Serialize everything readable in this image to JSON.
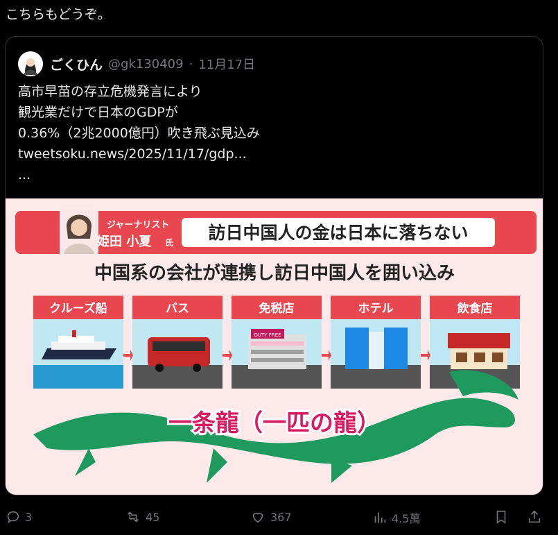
{
  "post_text": "こちらもどうぞ。",
  "quoted": {
    "author_name": "ごくひん",
    "author_handle": "@gk130409",
    "separator": "·",
    "date": "11月17日",
    "body": "高市早苗の存立危機発言により\n観光業だけで日本のGDPが\n0.36%（2兆2000億円）吹き飛ぶ見込み\ntweetsoku.news/2025/11/17/gdp...\n...",
    "image": {
      "role": "ジャーナリスト",
      "person_name": "姫田 小夏",
      "honorific": "氏",
      "headline": "訪日中国人の金は日本に落ちない",
      "subheadline": "中国系の会社が連携し訪日中国人を囲い込み",
      "steps": [
        "クルーズ船",
        "バス",
        "免税店",
        "ホテル",
        "飲食店"
      ],
      "bottom_text": "一条龍（一匹の龍）",
      "duty_free_sign": "DUTY FREE"
    }
  },
  "actions": {
    "replies": "3",
    "retweets": "45",
    "likes": "367",
    "views": "4.5萬"
  },
  "colors": {
    "background": "#000000",
    "muted": "#71767b",
    "banner_red": "#e8474f",
    "graphic_bg": "#fde8ea",
    "dragon_green": "#1e9a5e"
  }
}
